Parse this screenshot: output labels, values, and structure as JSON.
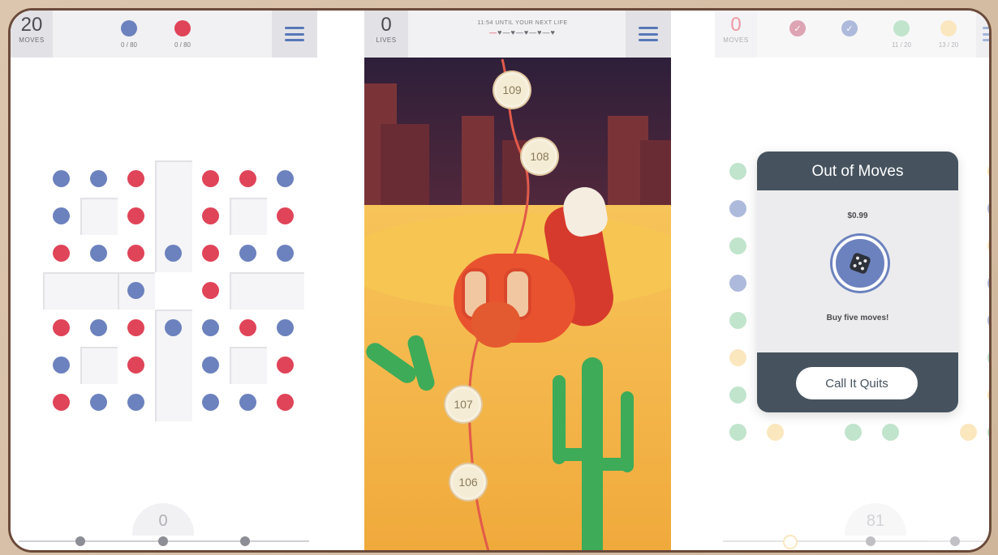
{
  "colors": {
    "blue": "#6c82be",
    "red": "#e04458",
    "green": "#8ecfa4",
    "yellow": "#f6d48a",
    "slate": "#46535f"
  },
  "screen1": {
    "moves_value": "20",
    "moves_label": "MOVES",
    "goals": [
      {
        "color": "blue",
        "count": "0 / 80"
      },
      {
        "color": "red",
        "count": "0 / 80"
      }
    ],
    "score": "0"
  },
  "screen2": {
    "lives_value": "0",
    "lives_label": "LIVES",
    "timer_text": "11:54 UNTIL YOUR NEXT LIFE",
    "levels": [
      "109",
      "108",
      "107",
      "106"
    ]
  },
  "screen3": {
    "moves_value": "0",
    "moves_label": "MOVES",
    "goals": [
      {
        "color": "red",
        "count": "",
        "done": true
      },
      {
        "color": "blue",
        "count": "",
        "done": true
      },
      {
        "color": "green",
        "count": "11 / 20",
        "done": false
      },
      {
        "color": "yellow",
        "count": "13 / 20",
        "done": false
      }
    ],
    "modal": {
      "title": "Out of Moves",
      "price": "$0.99",
      "offer": "Buy five moves!",
      "quit_label": "Call It Quits"
    },
    "score": "81"
  }
}
